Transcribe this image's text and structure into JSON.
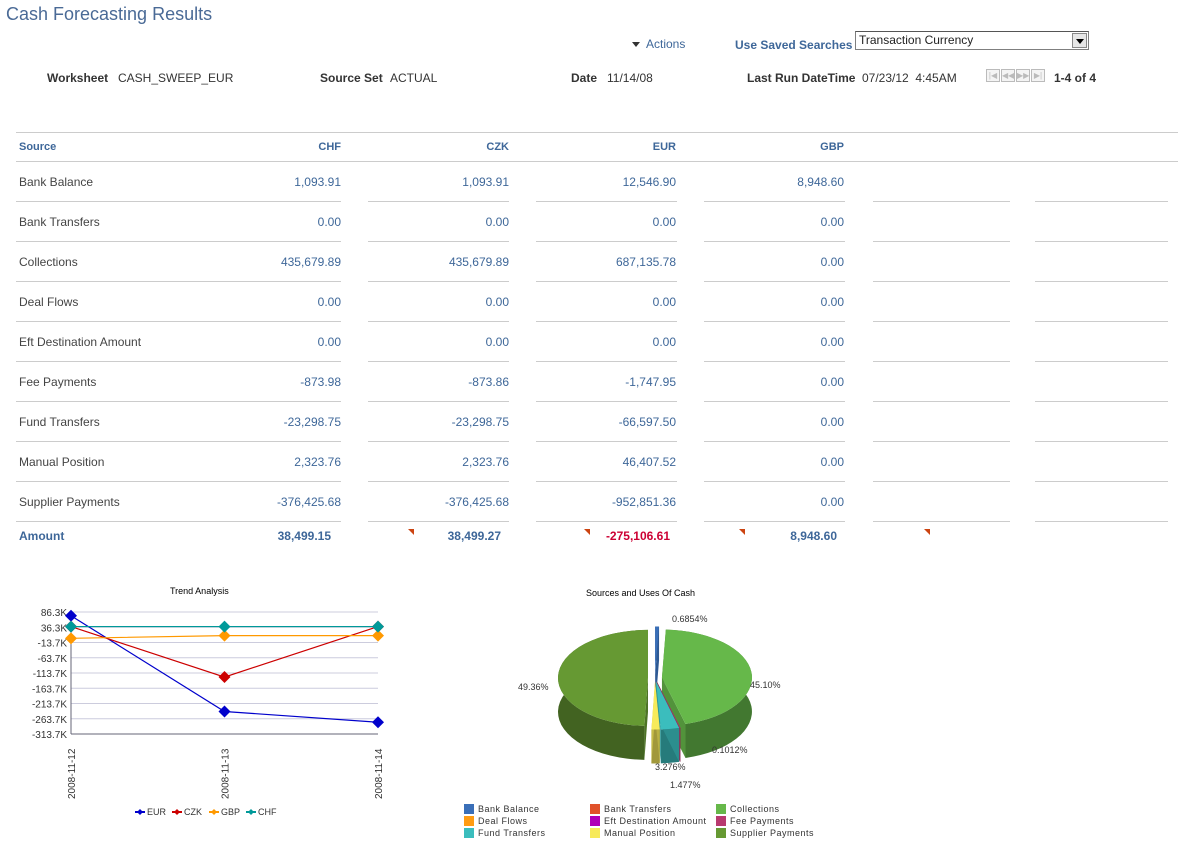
{
  "page": {
    "title": "Cash Forecasting Results",
    "actions_label": "Actions",
    "saved_searches_label": "Use Saved Searches",
    "saved_searches_value": "Transaction Currency"
  },
  "meta": {
    "worksheet_label": "Worksheet",
    "worksheet_value": "CASH_SWEEP_EUR",
    "source_set_label": "Source Set",
    "source_set_value": "ACTUAL",
    "date_label": "Date",
    "date_value": "11/14/08",
    "last_run_label": "Last Run DateTime",
    "last_run_value": "07/23/12  4:45AM",
    "pager": "1-4 of 4"
  },
  "nav_icons": [
    "first-icon",
    "previous-icon",
    "next-icon",
    "last-icon"
  ],
  "table": {
    "headers": [
      "Source",
      "CHF",
      "CZK",
      "EUR",
      "GBP"
    ],
    "rows": [
      {
        "source": "Bank Balance",
        "values": [
          "1,093.91",
          "1,093.91",
          "12,546.90",
          "8,948.60"
        ]
      },
      {
        "source": "Bank Transfers",
        "values": [
          "0.00",
          "0.00",
          "0.00",
          "0.00"
        ]
      },
      {
        "source": "Collections",
        "values": [
          "435,679.89",
          "435,679.89",
          "687,135.78",
          "0.00"
        ]
      },
      {
        "source": "Deal Flows",
        "values": [
          "0.00",
          "0.00",
          "0.00",
          "0.00"
        ]
      },
      {
        "source": "Eft Destination Amount",
        "values": [
          "0.00",
          "0.00",
          "0.00",
          "0.00"
        ]
      },
      {
        "source": "Fee Payments",
        "values": [
          "-873.98",
          "-873.86",
          "-1,747.95",
          "0.00"
        ]
      },
      {
        "source": "Fund Transfers",
        "values": [
          "-23,298.75",
          "-23,298.75",
          "-66,597.50",
          "0.00"
        ]
      },
      {
        "source": "Manual Position",
        "values": [
          "2,323.76",
          "2,323.76",
          "46,407.52",
          "0.00"
        ]
      },
      {
        "source": "Supplier Payments",
        "values": [
          "-376,425.68",
          "-376,425.68",
          "-952,851.36",
          "0.00"
        ]
      }
    ],
    "amount_label": "Amount",
    "amounts": [
      "38,499.15",
      "38,499.27",
      "-275,106.61",
      "8,948.60"
    ],
    "amount_colors": [
      "#3e6799",
      "#3e6799",
      "#cc0033",
      "#3e6799"
    ]
  },
  "chart_data": [
    {
      "type": "line",
      "title": "Trend Analysis",
      "x": [
        "2008-11-12",
        "2008-11-13",
        "2008-11-14"
      ],
      "yticks": [
        "86.3K",
        "36.3K",
        "-13.7K",
        "-63.7K",
        "-113.7K",
        "-163.7K",
        "-213.7K",
        "-263.7K",
        "-313.7K"
      ],
      "ylim": [
        -313.7,
        86.3
      ],
      "yunit": "K",
      "grid": true,
      "legend_position": "bottom",
      "series": [
        {
          "name": "EUR",
          "color": "#0000cc",
          "values": [
            74,
            -240,
            -275.1
          ]
        },
        {
          "name": "CZK",
          "color": "#cc0000",
          "values": [
            38.5,
            -127,
            38.5
          ]
        },
        {
          "name": "GBP",
          "color": "#ff9900",
          "values": [
            0,
            8.9,
            8.9
          ]
        },
        {
          "name": "CHF",
          "color": "#009999",
          "values": [
            38.5,
            38.5,
            38.5
          ]
        }
      ]
    },
    {
      "type": "pie",
      "title": "Sources and Uses Of Cash",
      "legend_position": "bottom",
      "slices": [
        {
          "name": "Bank Balance",
          "value": 0.6854,
          "label": "0.6854%",
          "color": "#3a6fb8"
        },
        {
          "name": "Bank Transfers",
          "value": 0,
          "label": "",
          "color": "#e0522a"
        },
        {
          "name": "Collections",
          "value": 45.1,
          "label": "45.10%",
          "color": "#66b84a"
        },
        {
          "name": "Deal Flows",
          "value": 0,
          "label": "",
          "color": "#ff9c13"
        },
        {
          "name": "Eft Destination Amount",
          "value": 0,
          "label": "",
          "color": "#b000b8"
        },
        {
          "name": "Fee Payments",
          "value": 0.1012,
          "label": "0.1012%",
          "color": "#b83a6f"
        },
        {
          "name": "Fund Transfers",
          "value": 3.276,
          "label": "3.276%",
          "color": "#3bbdbd"
        },
        {
          "name": "Manual Position",
          "value": 1.477,
          "label": "1.477%",
          "color": "#f7ea5a"
        },
        {
          "name": "Supplier Payments",
          "value": 49.36,
          "label": "49.36%",
          "color": "#669933"
        }
      ]
    }
  ]
}
